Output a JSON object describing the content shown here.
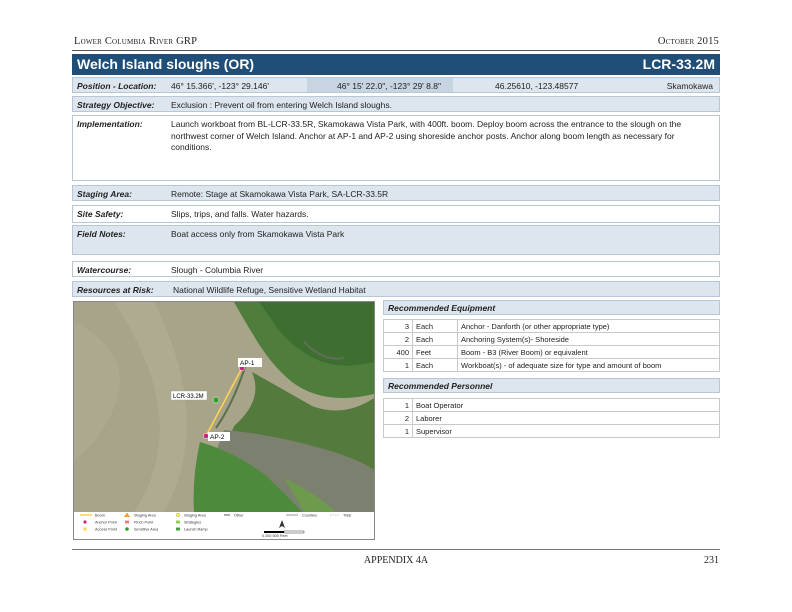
{
  "header": {
    "left": "Lower Columbia River GRP",
    "right": "October 2015"
  },
  "title": {
    "name": "Welch Island sloughs (OR)",
    "id": "LCR-33.2M"
  },
  "location": {
    "label": "Position - Location:",
    "decimal_minutes": "46° 15.366', -123° 29.146'",
    "dms": "46° 15' 22.0\", -123° 29' 8.8\"",
    "decimal": "46.25610, -123.48577",
    "place": "Skamokawa"
  },
  "strategy": {
    "label": "Strategy Objective:",
    "value": "Exclusion :   Prevent oil from entering Welch Island sloughs."
  },
  "implementation": {
    "label": "Implementation:",
    "value": "Launch workboat from BL-LCR-33.5R, Skamokawa Vista Park, with 400ft. boom. Deploy boom across the entrance to the slough on the northwest corner of Welch Island. Anchor at AP-1 and AP-2 using shoreside anchor posts.  Anchor along boom length as necessary for conditions."
  },
  "staging": {
    "label": "Staging Area:",
    "value": "Remote:  Stage at Skamokawa Vista Park, SA-LCR-33.5R"
  },
  "safety": {
    "label": "Site Safety:",
    "value": "Slips, trips, and falls. Water hazards."
  },
  "field_notes": {
    "label": "Field Notes:",
    "value": "Boat access only from Skamokawa Vista Park"
  },
  "watercourse": {
    "label": "Watercourse:",
    "value": "Slough  - Columbia River"
  },
  "resources": {
    "label": "Resources at Risk:",
    "value": "National Wildlife Refuge, Sensitive Wetland Habitat"
  },
  "map": {
    "strategy_label": "LCR-33.2M",
    "ap1": "AP-1",
    "ap2": "AP-2",
    "legend": [
      "Boom",
      "Anchor Point",
      "Access Point",
      "Staging Area",
      "Pinch Point",
      "Sensitive Area",
      "Staging Area",
      "Strategies",
      "Launch Ramp",
      "Other",
      "Counties",
      "Tidal"
    ],
    "scale": "0    250   500 Feet"
  },
  "equipment": {
    "title": "Recommended Equipment",
    "rows": [
      {
        "qty": "3",
        "unit": "Each",
        "desc": "Anchor - Danforth (or other appropriate type)"
      },
      {
        "qty": "2",
        "unit": "Each",
        "desc": "Anchoring System(s)- Shoreside"
      },
      {
        "qty": "400",
        "unit": "Feet",
        "desc": "Boom - B3 (River Boom) or equivalent"
      },
      {
        "qty": "1",
        "unit": "Each",
        "desc": "Workboat(s)  - of adequate size for type and amount of boom"
      }
    ]
  },
  "personnel": {
    "title": "Recommended Personnel",
    "rows": [
      {
        "qty": "1",
        "desc": "Boat Operator"
      },
      {
        "qty": "2",
        "desc": "Laborer"
      },
      {
        "qty": "1",
        "desc": "Supervisor"
      }
    ]
  },
  "footer": {
    "center": "APPENDIX 4A",
    "page": "231"
  },
  "colors": {
    "title_bar": "#1f4e79",
    "row_fill": "#dde6ef",
    "boom": "#ffd24d"
  }
}
